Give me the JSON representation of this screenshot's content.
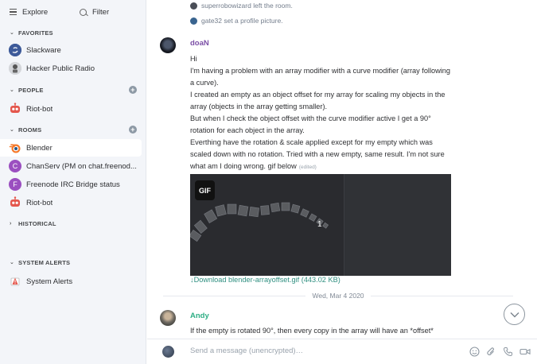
{
  "sidebar": {
    "explore_label": "Explore",
    "filter_label": "Filter",
    "sections": {
      "favorites": "FAVORITES",
      "people": "PEOPLE",
      "rooms": "ROOMS",
      "historical": "HISTORICAL",
      "system_alerts": "SYSTEM ALERTS"
    },
    "favorites": [
      {
        "label": "Slackware"
      },
      {
        "label": "Hacker Public Radio"
      }
    ],
    "people": [
      {
        "label": "Riot-bot"
      }
    ],
    "rooms": [
      {
        "label": "Blender",
        "active": true
      },
      {
        "label": "ChanServ (PM on chat.freenod...",
        "letter": "C"
      },
      {
        "label": "Freenode IRC Bridge status",
        "letter": "F"
      },
      {
        "label": "Riot-bot"
      }
    ],
    "system_alerts_items": [
      {
        "label": "System Alerts"
      }
    ]
  },
  "timeline": {
    "events": [
      {
        "text": "superrobowizard left the room."
      },
      {
        "text": "gate32 set a profile picture."
      }
    ],
    "message1": {
      "sender": "doaN",
      "lines": [
        "Hi",
        "I'm having a problem  with an array modifier with a curve modifier (array following a curve).",
        "I created an empty as an object offset for my array for scaling my objects in the array (objects in the array getting smaller).",
        "But when I check the object offset with the curve modifier active I get a 90° rotation for each object in the array.",
        "Everthing have the rotation & scale applied except for my empty which was scaled down with no rotation. Tried with a new empty, same result. I'm not sure what am I doing wrong. gif below"
      ],
      "edited": "(edited)",
      "gif_badge": "GIF",
      "gif_number": "1",
      "download": "Download blender-arrayoffset.gif (443.02 KB)"
    },
    "date_separator": "Wed, Mar 4 2020",
    "message2": {
      "sender": "Andy",
      "text": "If the empty is rotated 90°, then every copy in the array will have an *offset*"
    }
  },
  "composer": {
    "placeholder": "Send a message (unencrypted)…"
  },
  "colors": {
    "accent": "#7b4fa6",
    "andy": "#2dae84",
    "link": "#2f8f80",
    "sidebar_bg": "#f3f5f9"
  }
}
